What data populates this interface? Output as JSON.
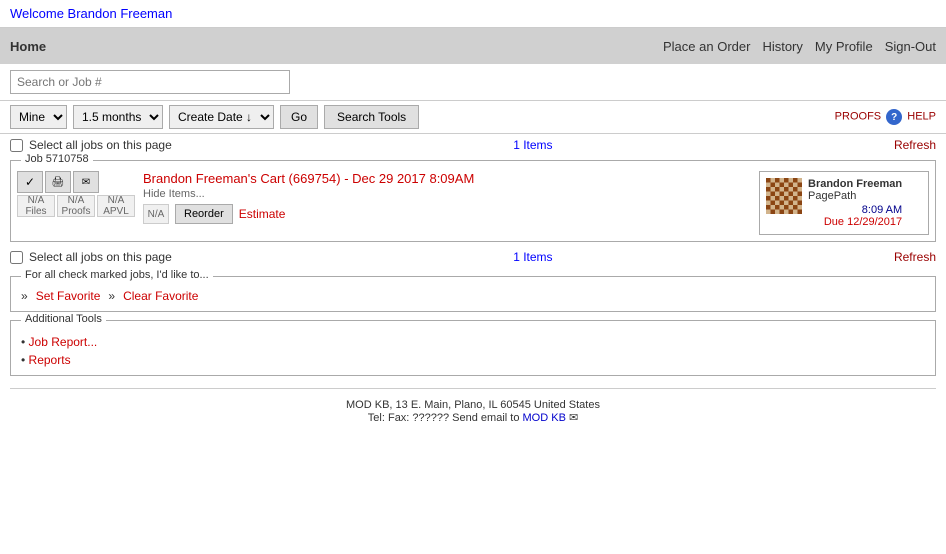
{
  "welcome": {
    "text": "Welcome Brandon Freeman"
  },
  "nav": {
    "home": "Home",
    "place_order": "Place an Order",
    "history": "History",
    "my_profile": "My Profile",
    "sign_out": "Sign-Out"
  },
  "search": {
    "placeholder": "Search or Job #"
  },
  "filter": {
    "mine_option": "Mine",
    "date_range": "1.5 months",
    "sort": "Create Date ↓",
    "go_label": "Go",
    "search_tools_label": "Search Tools",
    "proofs_label": "PROOFS",
    "help_label": "HELP"
  },
  "items": {
    "select_all_label": "Select all jobs on this page",
    "count": "1 Items",
    "refresh": "Refresh"
  },
  "job": {
    "group_title": "Job 5710758",
    "title": "Brandon Freeman's Cart (669754) - Dec 29 2017 8:09AM",
    "hide_items": "Hide Items...",
    "na_files": "N/A\nFiles",
    "na_proofs": "N/A\nProofs",
    "na_apvl": "N/A\nAPVL",
    "na_small": "N/A",
    "reorder": "Reorder",
    "estimate": "Estimate",
    "card": {
      "name": "Brandon Freeman",
      "company": "PagePath",
      "time": "8:09 AM",
      "due": "Due 12/29/2017"
    }
  },
  "for_all": {
    "group_title": "For all check marked jobs, I'd like to...",
    "set_favorite": "Set Favorite",
    "clear_favorite": "Clear Favorite"
  },
  "additional": {
    "group_title": "Additional Tools",
    "job_report": "Job Report...",
    "reports": "Reports"
  },
  "footer": {
    "address": "MOD KB, 13 E. Main, Plano, IL 60545 United States",
    "tel_fax": "Tel: Fax: ?????? Send email to",
    "mod_kb": "MOD KB"
  }
}
